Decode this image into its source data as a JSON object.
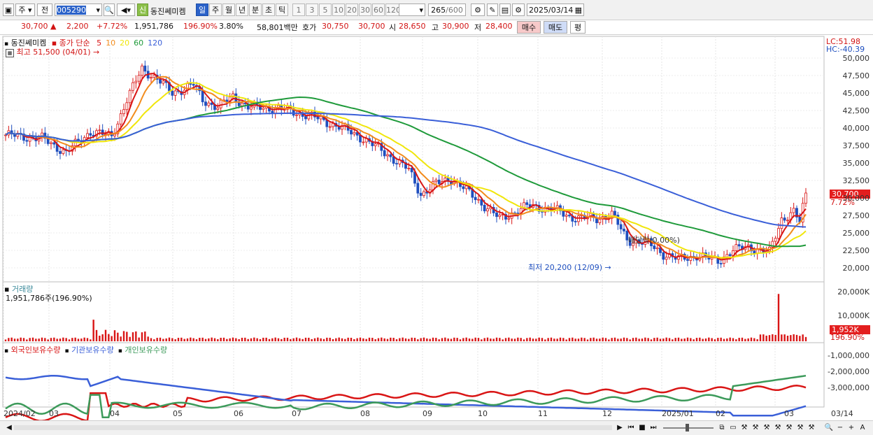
{
  "toolbar": {
    "view_label": "주",
    "prev_label": "전",
    "code": "005290",
    "badge": "신",
    "stock_name": "동진쎄미켐",
    "periods": [
      "일",
      "주",
      "월",
      "년",
      "분",
      "초",
      "틱"
    ],
    "active_period": "일",
    "counts": [
      "1",
      "3",
      "5",
      "10",
      "20",
      "30",
      "60",
      "120"
    ],
    "range": "265",
    "range_max": "/600",
    "date": "2025/03/14"
  },
  "quote": {
    "price": "30,700",
    "change": "2,200",
    "change_pct": "+7.72%",
    "volume": "1,951,786",
    "volume_ratio": "196.90%",
    "turnover": "3.80%",
    "amount": "58,801백만",
    "hoga_label": "호가",
    "ask": "30,750",
    "bid": "30,700",
    "open_label": "시",
    "open": "28,650",
    "high_label": "고",
    "high": "30,900",
    "low_label": "저",
    "low": "28,400",
    "buy_label": "매수",
    "sell_label": "매도",
    "eval_label": "평"
  },
  "price_panel": {
    "title": "동진쎄미켐",
    "ma_label": "종가 단순",
    "ma_periods": [
      "5",
      "10",
      "20",
      "60",
      "120"
    ],
    "ma_colors": [
      "#d91515",
      "#f28c1c",
      "#f0e60b",
      "#1e9a3a",
      "#3a5fd8"
    ],
    "high_note": "최고 51,500 (04/01)",
    "low_note": "최저 20,200 (12/09)",
    "dividend_note": "배당락(0.00%)",
    "lc": "LC:51.98",
    "hc": "HC:-40.39",
    "price_tag": "30,700",
    "pct_tag": "7.72%",
    "y_ticks": [
      "50,000",
      "47,500",
      "45,000",
      "42,500",
      "40,000",
      "37,500",
      "35,000",
      "32,500",
      "30,000",
      "27,500",
      "25,000",
      "22,500",
      "20,000"
    ]
  },
  "volume_panel": {
    "title": "거래량",
    "value_note": "1,951,786주(196.90%)",
    "y_ticks": [
      "20,000K",
      "10,000K"
    ],
    "tag": "1,952K",
    "tag_pct": "196.90%"
  },
  "holding_panel": {
    "legend": [
      "외국인보유수량",
      "기관보유수량",
      "개인보유수량"
    ],
    "colors": [
      "#d91515",
      "#3a5fd8",
      "#3c9a5a"
    ],
    "y_ticks": [
      "-1,000,000",
      "-2,000,000",
      "-3,000,000"
    ]
  },
  "x_axis": [
    "2024/02",
    "03",
    "04",
    "05",
    "06",
    "07",
    "08",
    "09",
    "10",
    "11",
    "12",
    "2025/01",
    "02",
    "03",
    "03/14"
  ]
}
